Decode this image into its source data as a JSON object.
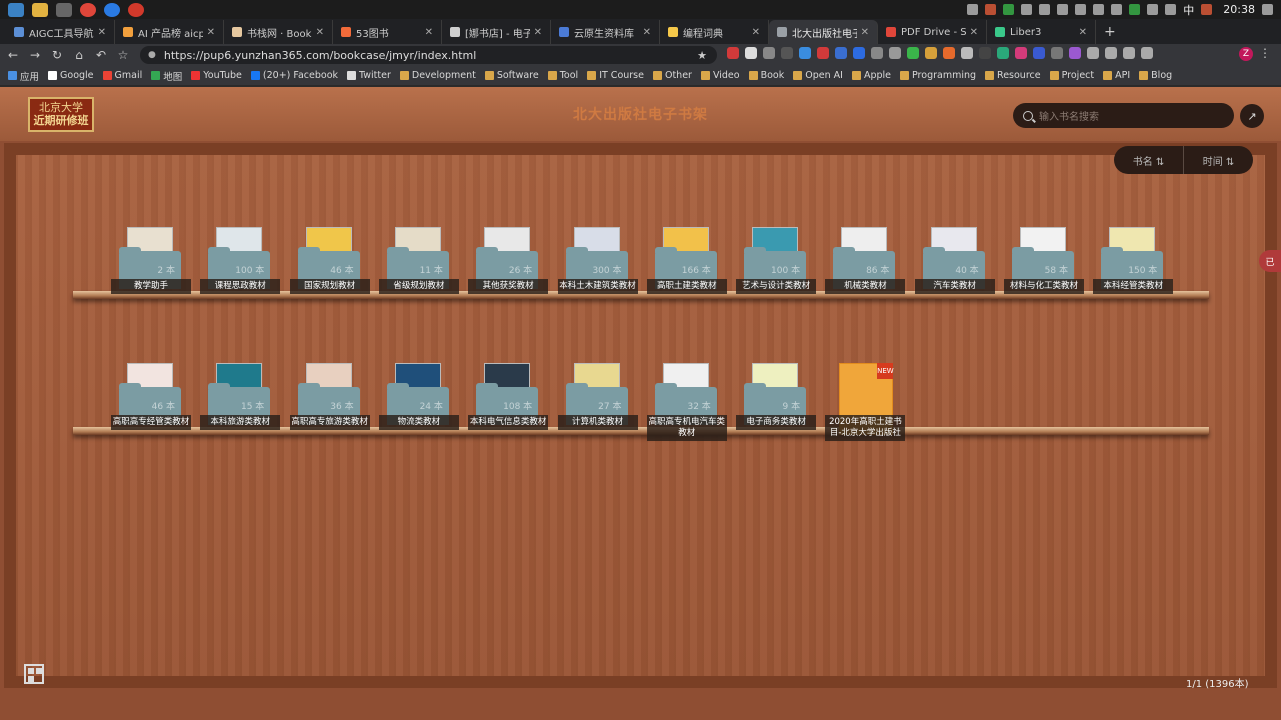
{
  "os": {
    "clock": "20:38",
    "lang": "中"
  },
  "tabs": [
    {
      "title": "AIGC工具导航 | 生",
      "color": "#5c8fd6"
    },
    {
      "title": "AI 产品榜 aicpb.c",
      "color": "#f2a03d"
    },
    {
      "title": "书栈网 · BookStac",
      "color": "#e6c8a0"
    },
    {
      "title": "53图书",
      "color": "#f26b3a"
    },
    {
      "title": "[娜书店] - 电子书/",
      "color": "#cfcfcf"
    },
    {
      "title": "云原生资料库",
      "color": "#4b7bd6"
    },
    {
      "title": "编程词典",
      "color": "#f5c84a"
    },
    {
      "title": "北大出版社电子书",
      "color": "#9aa0a6",
      "active": true
    },
    {
      "title": "PDF Drive - Sear",
      "color": "#e0463a"
    },
    {
      "title": "Liber3",
      "color": "#3ac88a"
    }
  ],
  "new_tab": "+",
  "url": "https://pup6.yunzhan365.com/bookcase/jmyr/index.html",
  "profile": "Z",
  "bookmarks": [
    "应用",
    "Google",
    "Gmail",
    "地图",
    "YouTube",
    "(20+) Facebook",
    "Twitter",
    "Development",
    "Software",
    "Tool",
    "IT Course",
    "Other",
    "Video",
    "Book",
    "Open AI",
    "Apple",
    "Programming",
    "Resource",
    "Project",
    "API",
    "Blog"
  ],
  "logo": {
    "line1": "北京大学",
    "line2": "近期研修班"
  },
  "site_title": "北大出版社电子书架",
  "search_placeholder": "输入书名搜索",
  "sort": {
    "by_name": "书名 ⇅",
    "by_time": "时间 ⇅"
  },
  "shelf1": [
    {
      "label": "教学助手",
      "count": "2 本"
    },
    {
      "label": "课程思政教材",
      "count": "100 本"
    },
    {
      "label": "国家规划教材",
      "count": "46 本"
    },
    {
      "label": "省级规划教材",
      "count": "11 本"
    },
    {
      "label": "其他获奖教材",
      "count": "26 本"
    },
    {
      "label": "本科土木建筑类教材",
      "count": "300 本"
    },
    {
      "label": "高职土建类教材",
      "count": "166 本"
    },
    {
      "label": "艺术与设计类教材",
      "count": "100 本"
    },
    {
      "label": "机械类教材",
      "count": "86 本"
    },
    {
      "label": "汽车类教材",
      "count": "40 本"
    },
    {
      "label": "材料与化工类教材",
      "count": "58 本"
    },
    {
      "label": "本科经管类教材",
      "count": "150 本"
    }
  ],
  "shelf2": [
    {
      "label": "高职高专经管类教材",
      "count": "46 本"
    },
    {
      "label": "本科旅游类教材",
      "count": "15 本"
    },
    {
      "label": "高职高专旅游类教材",
      "count": "36 本"
    },
    {
      "label": "物流类教材",
      "count": "24 本"
    },
    {
      "label": "本科电气信息类教材",
      "count": "108 本"
    },
    {
      "label": "计算机类教材",
      "count": "27 本"
    },
    {
      "label": "高职高专机电汽车类教材",
      "count": "32 本"
    },
    {
      "label": "电子商务类教材",
      "count": "9 本"
    },
    {
      "label": "2020年高职土建书目-北京大学出版社",
      "count": "",
      "new": true,
      "tag": "NEW"
    }
  ],
  "pager": "1/1 (1396本)",
  "side_pin": "已"
}
